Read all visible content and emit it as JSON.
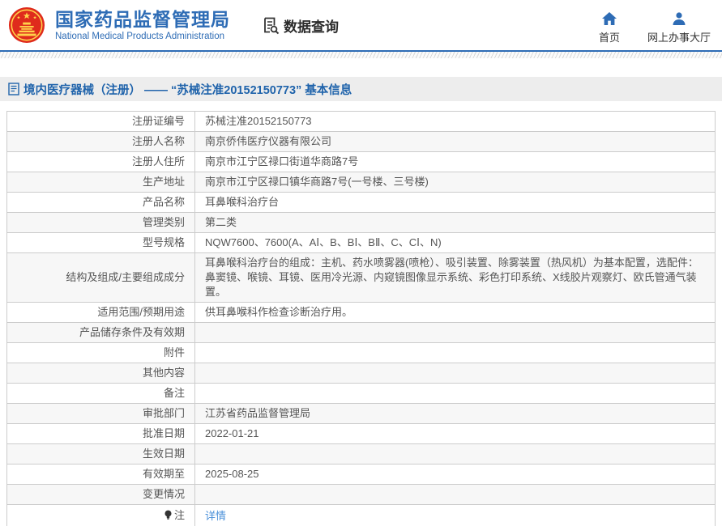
{
  "header": {
    "title": "国家药品监督管理局",
    "subtitle": "National Medical Products Administration",
    "data_query_label": "数据查询",
    "nav_home_label": "首页",
    "nav_hall_label": "网上办事大厅"
  },
  "breadcrumb": {
    "text": "境内医疗器械（注册） —— “苏械注准20152150773” 基本信息"
  },
  "table": {
    "rows": [
      {
        "label": "注册证编号",
        "value": "苏械注准20152150773"
      },
      {
        "label": "注册人名称",
        "value": "南京侨伟医疗仪器有限公司"
      },
      {
        "label": "注册人住所",
        "value": "南京市江宁区禄口街道华商路7号"
      },
      {
        "label": "生产地址",
        "value": "南京市江宁区禄口镇华商路7号(一号楼、三号楼)"
      },
      {
        "label": "产品名称",
        "value": "耳鼻喉科治疗台"
      },
      {
        "label": "管理类别",
        "value": "第二类"
      },
      {
        "label": "型号规格",
        "value": "NQW7600、7600(A、AⅠ、B、BⅠ、BⅡ、C、CⅠ、N)"
      },
      {
        "label": "结构及组成/主要组成成分",
        "value": "耳鼻喉科治疗台的组成：主机、药水喷雾器(喷枪）、吸引装置、除雾装置（热风机）为基本配置，选配件：鼻窦镜、喉镜、耳镜、医用冷光源、内窥镜图像显示系统、彩色打印系统、X线胶片观察灯、欧氏管通气装置。"
      },
      {
        "label": "适用范围/预期用途",
        "value": "供耳鼻喉科作检查诊断治疗用。"
      },
      {
        "label": "产品储存条件及有效期",
        "value": ""
      },
      {
        "label": "附件",
        "value": ""
      },
      {
        "label": "其他内容",
        "value": ""
      },
      {
        "label": "备注",
        "value": ""
      },
      {
        "label": "审批部门",
        "value": "江苏省药品监督管理局"
      },
      {
        "label": "批准日期",
        "value": "2022-01-21"
      },
      {
        "label": "生效日期",
        "value": ""
      },
      {
        "label": "有效期至",
        "value": "2025-08-25"
      },
      {
        "label": "变更情况",
        "value": ""
      },
      {
        "label": "注",
        "value": "详情",
        "value_type": "link",
        "label_icon": "bulb-icon"
      }
    ]
  },
  "colors": {
    "accent_blue": "#2e6cb5",
    "breadcrumb_blue": "#1f63ab",
    "link_blue": "#4a90d9",
    "emblem_red": "#df2b1c",
    "emblem_gold": "#ffd24a"
  }
}
